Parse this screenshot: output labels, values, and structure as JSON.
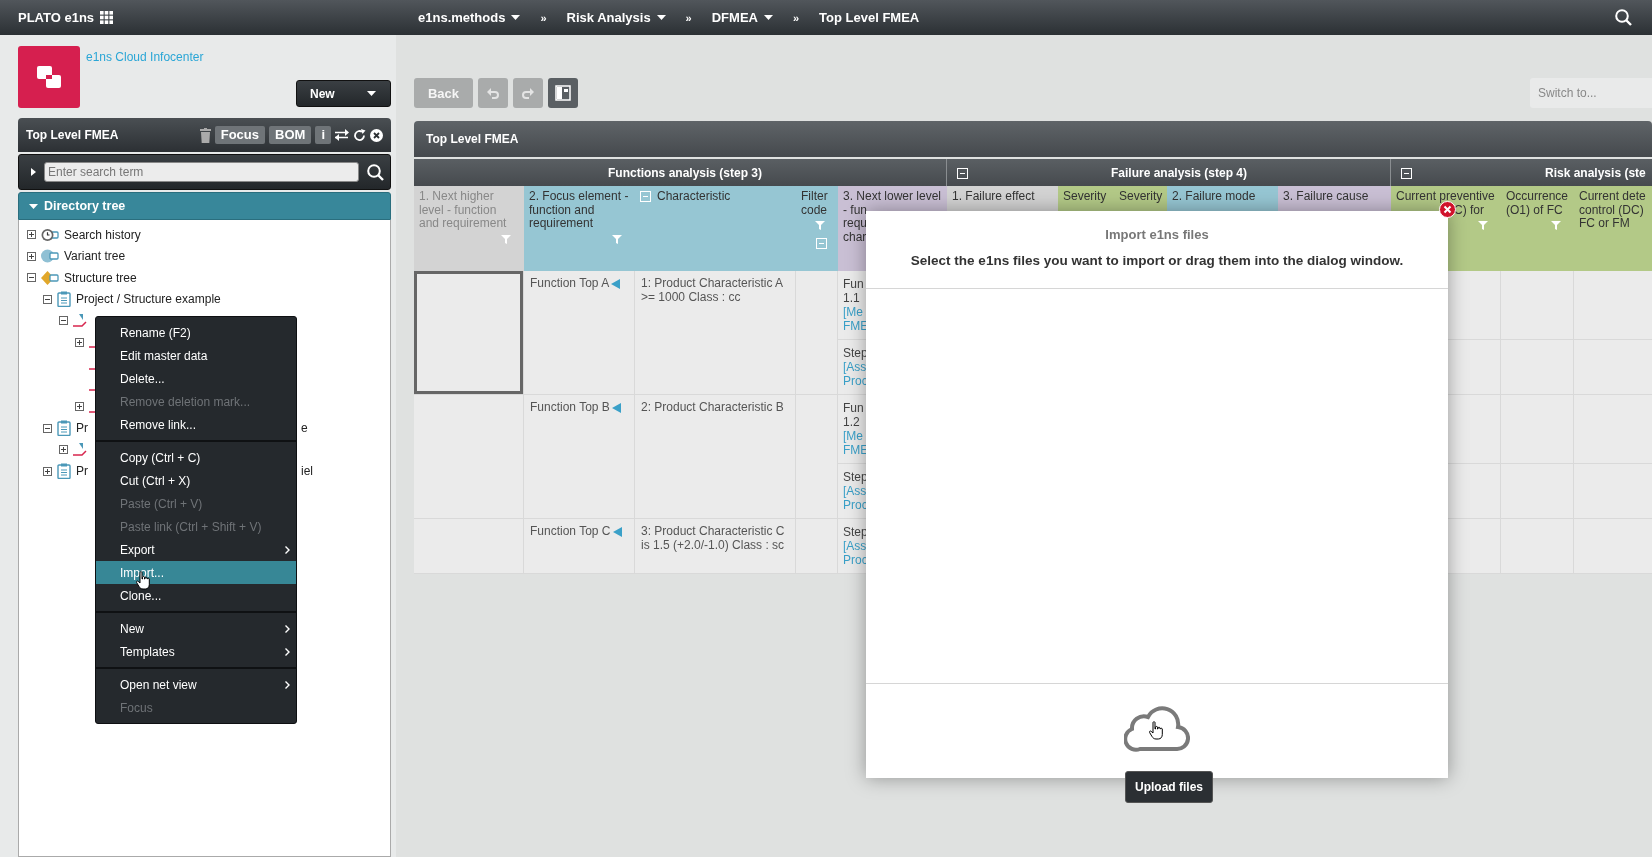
{
  "top_bar": {
    "brand": "PLATO e1ns",
    "breadcrumbs": [
      {
        "kind": "crumb",
        "label": "e1ns.methods",
        "dropdown": true
      },
      {
        "kind": "separator",
        "label": "»"
      },
      {
        "kind": "crumb",
        "label": "Risk Analysis",
        "dropdown": true
      },
      {
        "kind": "separator",
        "label": "»"
      },
      {
        "kind": "crumb",
        "label": "DFMEA",
        "dropdown": true
      },
      {
        "kind": "separator",
        "label": "»"
      },
      {
        "kind": "crumb",
        "label": "Top Level FMEA",
        "dropdown": false
      }
    ]
  },
  "sidebar": {
    "link": "e1ns Cloud Infocenter",
    "new_button": "New",
    "panel": {
      "title": "Top Level FMEA",
      "buttons": [
        "Focus",
        "BOM",
        "i"
      ]
    },
    "search": {
      "placeholder": "Enter search term"
    },
    "tree_header": {
      "label": "Directory tree",
      "expanded": true
    },
    "tree": [
      {
        "label": "Search history",
        "kind": "history",
        "expanded": false
      },
      {
        "label": "Variant tree",
        "kind": "variant",
        "expanded": false
      },
      {
        "label": "Structure tree",
        "kind": "structure",
        "expanded": true,
        "children": [
          {
            "label": "Project / Structure example",
            "kind": "project",
            "expanded": true,
            "children": [
              {
                "kind": "fmea",
                "expanded": true,
                "children": [
                  {
                    "kind": "fmea",
                    "expanded": false
                  },
                  {
                    "kind": "fmea"
                  },
                  {
                    "kind": "fmea"
                  },
                  {
                    "kind": "fmea",
                    "expanded": false
                  }
                ]
              }
            ]
          },
          {
            "label": "Pr",
            "tail": "e",
            "kind": "project",
            "expanded": true,
            "children": [
              {
                "kind": "fmea",
                "expanded": false
              }
            ]
          },
          {
            "label": "Pr",
            "tail": "iel",
            "kind": "project",
            "expanded": false
          }
        ]
      }
    ]
  },
  "context_menu": {
    "groups": [
      [
        {
          "label": "Rename (F2)",
          "disabled": false,
          "selected": false,
          "submenu": false
        },
        {
          "label": "Edit master data",
          "disabled": false,
          "selected": false,
          "submenu": false
        },
        {
          "label": "Delete...",
          "disabled": false,
          "selected": false,
          "submenu": false
        },
        {
          "label": "Remove deletion mark...",
          "disabled": true,
          "selected": false,
          "submenu": false
        },
        {
          "label": "Remove link...",
          "disabled": false,
          "selected": false,
          "submenu": false
        }
      ],
      [
        {
          "label": "Copy (Ctrl + C)",
          "disabled": false,
          "selected": false,
          "submenu": false
        },
        {
          "label": "Cut (Ctrl + X)",
          "disabled": false,
          "selected": false,
          "submenu": false
        },
        {
          "label": "Paste (Ctrl + V)",
          "disabled": true,
          "selected": false,
          "submenu": false
        },
        {
          "label": "Paste link (Ctrl + Shift + V)",
          "disabled": true,
          "selected": false,
          "submenu": false
        },
        {
          "label": "Export",
          "disabled": false,
          "selected": false,
          "submenu": true
        },
        {
          "label": "Import...",
          "disabled": false,
          "selected": true,
          "submenu": false
        },
        {
          "label": "Clone...",
          "disabled": false,
          "selected": false,
          "submenu": false
        }
      ],
      [
        {
          "label": "New",
          "disabled": false,
          "selected": false,
          "submenu": true
        },
        {
          "label": "Templates",
          "disabled": false,
          "selected": false,
          "submenu": true
        }
      ],
      [
        {
          "label": "Open net view",
          "disabled": false,
          "selected": false,
          "submenu": true
        },
        {
          "label": "Focus",
          "disabled": true,
          "selected": false,
          "submenu": false
        }
      ]
    ]
  },
  "toolbar": {
    "buttons": [
      {
        "kind": "back",
        "label": "Back",
        "disabled": true
      },
      {
        "kind": "undo",
        "disabled": true
      },
      {
        "kind": "redo",
        "disabled": true
      },
      {
        "kind": "layout",
        "disabled": false
      }
    ],
    "switch": {
      "placeholder": "Switch to..."
    }
  },
  "fmea": {
    "title": "Top Level FMEA",
    "groups": [
      {
        "label": "Functions analysis (step 3)",
        "collapsible": false,
        "columns": [
          {
            "label": "1. Next higher level - function and requirement",
            "color": "#d3d3d3",
            "muted": true,
            "filter": true
          },
          {
            "label": "2. Focus element - function and requirement",
            "color": "#96c6d3",
            "filter": true
          },
          {
            "label": "Characteristic",
            "color": "#96c6d3",
            "collapsible": true
          },
          {
            "label": "Filter code",
            "color": "#96c6d3",
            "filter": true,
            "collapse_below": true
          },
          {
            "label": "3. Next lower level\n- fun\nrequ\nchar",
            "color": "#c9bfd4"
          }
        ]
      },
      {
        "label": "Failure analysis (step 4)",
        "collapsible": true,
        "columns": [
          {
            "label": "1. Failure effect",
            "color": "#d3d3d3"
          },
          {
            "label": "Severity",
            "color": "#b3c987"
          },
          {
            "label": "Severity",
            "color": "#b3c987"
          },
          {
            "label": "2. Failure mode",
            "color": "#96c6d3"
          },
          {
            "label": "3. Failure cause",
            "color": "#c9bfd4"
          }
        ]
      },
      {
        "label": "Risk analysis (ste",
        "collapsible": true,
        "columns": [
          {
            "label": "Current preventive",
            "fragment": "C) for",
            "color": "#b3c987",
            "filter": true
          },
          {
            "label": "Occurrence\n(O1) of FC",
            "color": "#b3c987",
            "filter": true
          },
          {
            "label": "Current dete\ncontrol (DC)\nFC or FM",
            "color": "#b3c987"
          }
        ]
      }
    ],
    "rows": [
      {
        "selected": true,
        "function": "Function Top A",
        "characteristic": "1: Product Characteristic A >= 1000 Class : cc",
        "lower": [
          {
            "lines": [
              {
                "text": "Fun",
                "link": false
              },
              {
                "text": "1.1",
                "link": false
              },
              {
                "text": "[Me",
                "link": true
              },
              {
                "text": "FME",
                "link": true
              }
            ]
          },
          {
            "lines": [
              {
                "text": "Step",
                "link": false
              },
              {
                "text": "[Ass",
                "link": true
              },
              {
                "text": "Proc",
                "link": true
              }
            ]
          }
        ]
      },
      {
        "selected": false,
        "function": "Function Top B",
        "characteristic": "2: Product Characteristic B",
        "lower": [
          {
            "lines": [
              {
                "text": "Fun",
                "link": false
              },
              {
                "text": "1.2",
                "link": false
              },
              {
                "text": "[Me",
                "link": true
              },
              {
                "text": "FME",
                "link": true
              }
            ]
          },
          {
            "lines": [
              {
                "text": "Step",
                "link": false
              },
              {
                "text": "[Ass",
                "link": true
              },
              {
                "text": "Proc",
                "link": true
              }
            ]
          }
        ]
      },
      {
        "selected": false,
        "function": "Function Top C",
        "characteristic": "3: Product Characteristic C is 1.5 (+2.0/-1.0) Class : sc",
        "lower": [
          {
            "lines": [
              {
                "text": "Step",
                "link": false
              },
              {
                "text": "[Ass",
                "link": true
              },
              {
                "text": "Proc",
                "link": true
              }
            ]
          }
        ]
      }
    ]
  },
  "dialog": {
    "title": "Import e1ns files",
    "message": "Select the e1ns files you want to import or drag them into the dialog window.",
    "tooltip": "Upload files"
  }
}
